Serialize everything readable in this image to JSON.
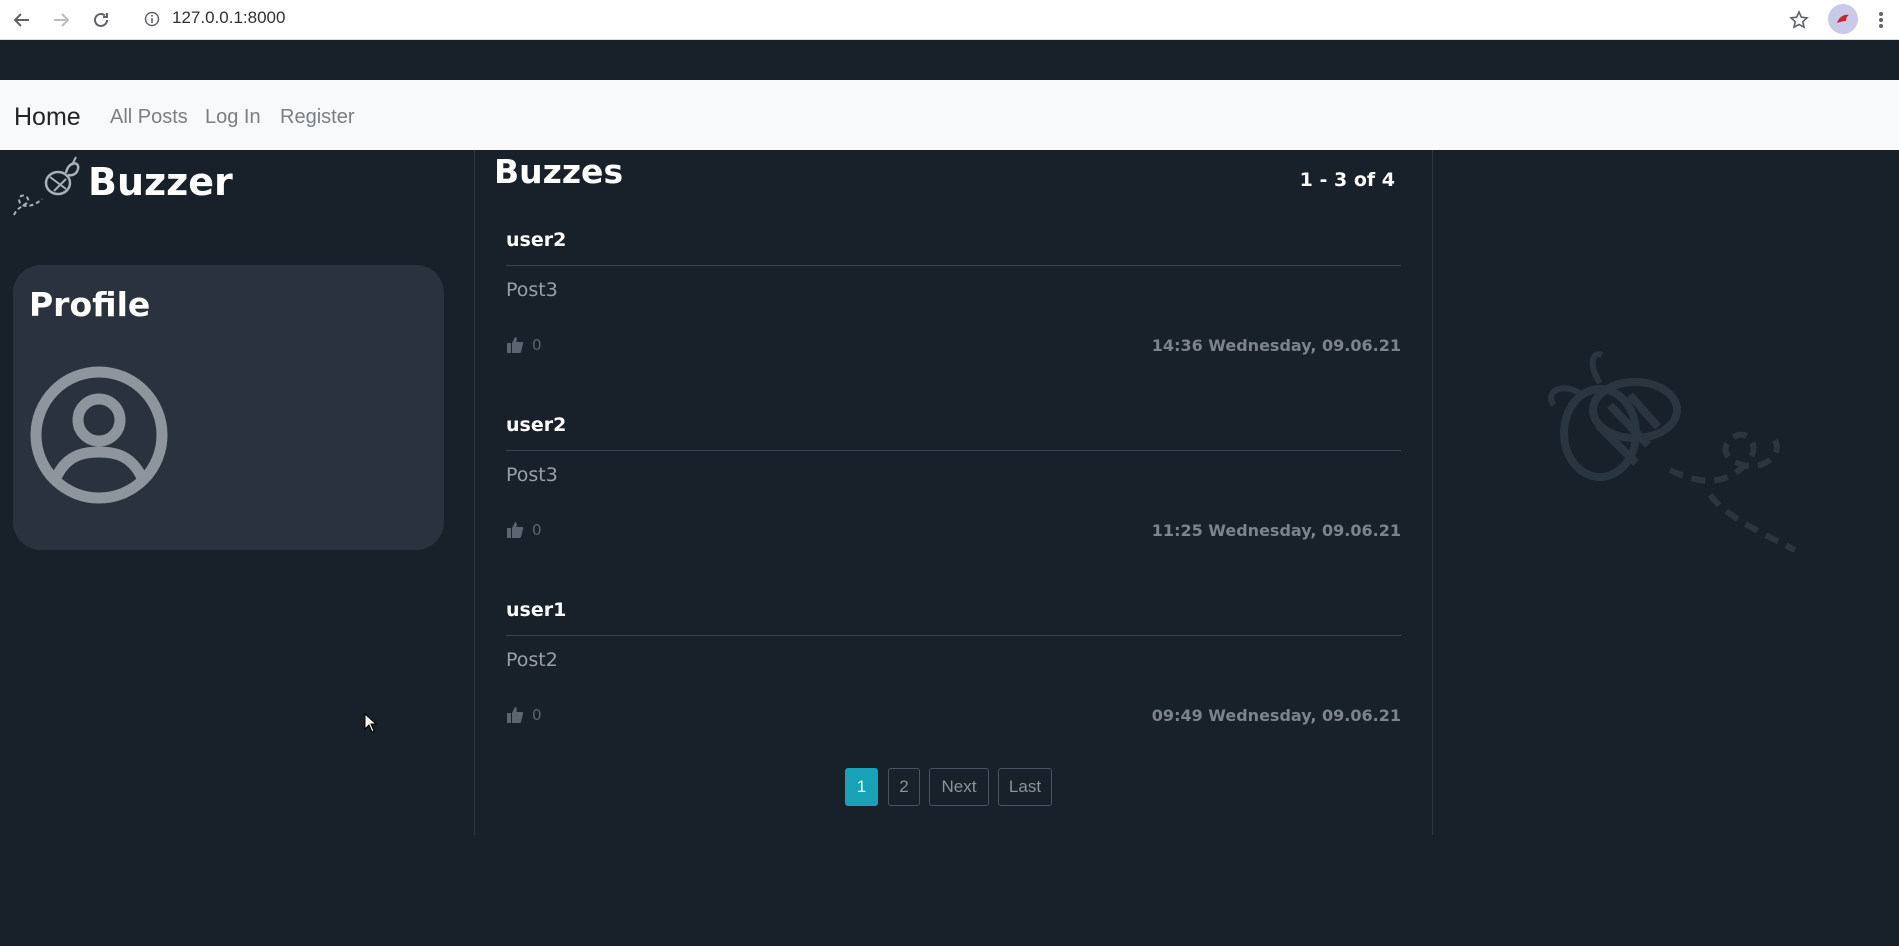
{
  "browser": {
    "url": "127.0.0.1:8000",
    "icons": [
      "back-icon",
      "forward-icon",
      "reload-icon",
      "info-icon",
      "star-icon",
      "profile-avatar-icon",
      "more-menu-icon"
    ]
  },
  "navbar": {
    "brand": "Home",
    "links": [
      "All Posts",
      "Log In",
      "Register"
    ]
  },
  "sidebar": {
    "logo_text": "Buzzer",
    "profile_title": "Profile"
  },
  "feed": {
    "title": "Buzzes",
    "count_label": "1 - 3 of 4",
    "posts": [
      {
        "user": "user2",
        "content": "Post3",
        "likes": "0",
        "timestamp": "14:36 Wednesday, 09.06.21"
      },
      {
        "user": "user2",
        "content": "Post3",
        "likes": "0",
        "timestamp": "11:25 Wednesday, 09.06.21"
      },
      {
        "user": "user1",
        "content": "Post2",
        "likes": "0",
        "timestamp": "09:49 Wednesday, 09.06.21"
      }
    ],
    "pagination": {
      "pages": [
        "1",
        "2"
      ],
      "next": "Next",
      "last": "Last"
    }
  },
  "colors": {
    "background": "#18202a",
    "card": "#2a333d",
    "accent": "#17a2b8",
    "navbar": "#f8f9fa"
  }
}
